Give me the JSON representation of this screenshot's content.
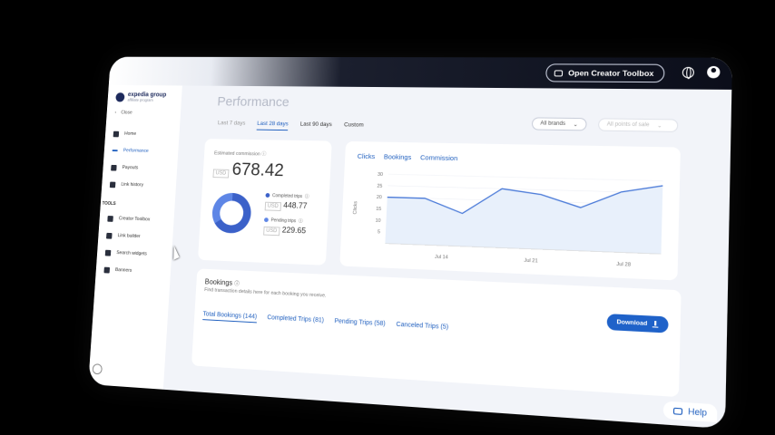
{
  "header": {
    "toolbox_label": "Open Creator Toolbox",
    "logo_text": "expedia group",
    "logo_sub": "affiliate program"
  },
  "sidebar": {
    "back_label": "Close",
    "items": [
      {
        "label": "Home"
      },
      {
        "label": "Performance"
      },
      {
        "label": "Payouts"
      },
      {
        "label": "Link history"
      }
    ],
    "tools_heading": "TOOLS",
    "tools": [
      {
        "label": "Creator Toolbox"
      },
      {
        "label": "Link builder"
      },
      {
        "label": "Search widgets"
      },
      {
        "label": "Banners"
      }
    ]
  },
  "main": {
    "title": "Performance",
    "tabs": [
      "Last 7 days",
      "Last 28 days",
      "Last 90 days",
      "Custom"
    ],
    "brands_select": "All brands",
    "pos_select": "All points of sale"
  },
  "commission": {
    "label": "Estimated commission",
    "currency": "USD",
    "value": "678.42",
    "completed_label": "Completed trips",
    "completed_value": "448.77",
    "pending_label": "Pending trips",
    "pending_value": "229.65",
    "completed_color": "#3b61c9",
    "pending_color": "#5e86e6",
    "completed_share": 0.66
  },
  "chart_tabs": [
    "Clicks",
    "Bookings",
    "Commission"
  ],
  "chart_data": {
    "type": "area",
    "ylabel": "Clicks",
    "ylim": [
      0,
      30
    ],
    "yticks": [
      5,
      10,
      15,
      20,
      25,
      30
    ],
    "xticks": [
      "Jul 14",
      "Jul 21",
      "Jul 28"
    ],
    "series": [
      {
        "values": [
          20,
          20,
          14,
          25,
          23,
          18,
          25,
          28
        ]
      }
    ],
    "color": "#4a7ad8"
  },
  "bookings": {
    "title": "Bookings",
    "subtitle": "Find transaction details here for each booking you receive.",
    "download_label": "Download",
    "tabs": [
      "Total Bookings (144)",
      "Completed Trips (81)",
      "Pending Trips (58)",
      "Canceled Trips (5)"
    ]
  },
  "help_label": "Help"
}
